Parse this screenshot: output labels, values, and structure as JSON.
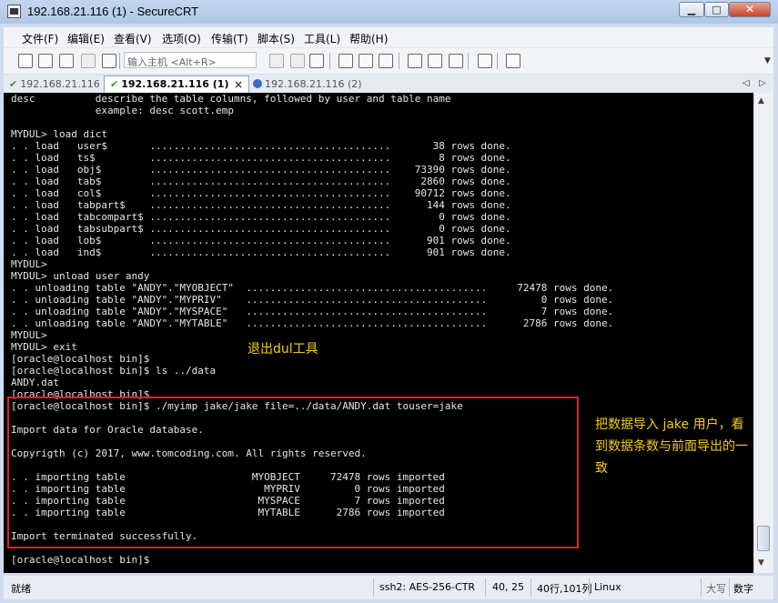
{
  "window": {
    "title": "192.168.21.116 (1) - SecureCRT",
    "min_label": "▁",
    "max_label": "□",
    "close_label": "✕"
  },
  "menu": [
    "文件(F)",
    "编辑(E)",
    "查看(V)",
    "选项(O)",
    "传输(T)",
    "脚本(S)",
    "工具(L)",
    "帮助(H)"
  ],
  "toolbar": {
    "quick_connect_placeholder": "输入主机 <Alt+R>"
  },
  "tabs": [
    {
      "label": "192.168.21.116",
      "state": "connected"
    },
    {
      "label": "192.168.21.116 (1)",
      "state": "active",
      "close": "×"
    },
    {
      "label": "192.168.21.116 (2)",
      "state": "info"
    }
  ],
  "tab_nav": {
    "prev": "◁",
    "next": "▷"
  },
  "terminal": {
    "lines": [
      "desc          describe the table columns, followed by user and table name",
      "              example: desc scott.emp",
      "",
      "MYDUL> load dict",
      ". . load   user$       ........................................       38 rows done.",
      ". . load   ts$         ........................................        8 rows done.",
      ". . load   obj$        ........................................    73390 rows done.",
      ". . load   tab$        ........................................     2860 rows done.",
      ". . load   col$        ........................................    90712 rows done.",
      ". . load   tabpart$    ........................................      144 rows done.",
      ". . load   tabcompart$ ........................................        0 rows done.",
      ". . load   tabsubpart$ ........................................        0 rows done.",
      ". . load   lob$        ........................................      901 rows done.",
      ". . load   ind$        ........................................      901 rows done.",
      "MYDUL>",
      "MYDUL> unload user andy",
      ". . unloading table \"ANDY\".\"MYOBJECT\"  ........................................     72478 rows done.",
      ". . unloading table \"ANDY\".\"MYPRIV\"    ........................................         0 rows done.",
      ". . unloading table \"ANDY\".\"MYSPACE\"   ........................................         7 rows done.",
      ". . unloading table \"ANDY\".\"MYTABLE\"   ........................................      2786 rows done.",
      "MYDUL>",
      "MYDUL> exit",
      "[oracle@localhost bin]$",
      "[oracle@localhost bin]$ ls ../data",
      "ANDY.dat",
      "[oracle@localhost bin]$",
      "[oracle@localhost bin]$ ./myimp jake/jake file=../data/ANDY.dat touser=jake",
      "",
      "Import data for Oracle database.",
      "",
      "Copyrigth (c) 2017, www.tomcoding.com. All rights reserved.",
      "",
      ". . importing table                     MYOBJECT     72478 rows imported",
      ". . importing table                       MYPRIV         0 rows imported",
      ". . importing table                      MYSPACE         7 rows imported",
      ". . importing table                      MYTABLE      2786 rows imported",
      "",
      "Import terminated successfully.",
      "",
      "[oracle@localhost bin]$"
    ]
  },
  "annotations": {
    "exit_note": "退出dul工具",
    "import_note": "把数据导入 jake 用户，看到数据条数与前面导出的一致",
    "color": "#f4cc13",
    "box_color": "#e0202a"
  },
  "statusbar": {
    "ready": "就绪",
    "cipher": "ssh2: AES-256-CTR",
    "cursor": "40,  25",
    "size": "40行,101列",
    "os": "Linux",
    "caps": "大写",
    "num": "数字"
  }
}
